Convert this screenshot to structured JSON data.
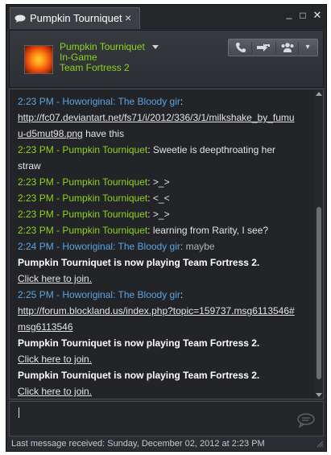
{
  "window": {
    "tab_title": "Pumpkin Tourniquet",
    "tab_close": "×",
    "controls": {
      "minimize": "_",
      "maximize": "□",
      "close": "✕"
    }
  },
  "header": {
    "name": "Pumpkin Tourniquet",
    "status": "In-Game",
    "game": "Team Fortress 2",
    "buttons": [
      "call-icon",
      "invite-icon",
      "group-icon",
      "dropdown-icon"
    ],
    "more_glyph": "▾",
    "colors": {
      "name": "#8fd21f",
      "ts_blue": "#5ba4e0"
    }
  },
  "messages": [
    {
      "time": "2:23 PM",
      "sep": " - ",
      "name": "Howoriginal: The Bloody gir",
      "colon": ":",
      "text": ""
    },
    {
      "link": "http://fc07.deviantart.net/fs71/i/2012/336/3/1/milkshake_by_fumu"
    },
    {
      "link": "u-d5mut98.png",
      "text": " have this"
    },
    {
      "time": "2:23 PM",
      "sep": " - ",
      "name": "Pumpkin Tourniquet",
      "colon": ":",
      "text": " Sweetie is deepthroating her"
    },
    {
      "text": "straw"
    },
    {
      "time": "2:23 PM",
      "sep": " - ",
      "name": "Pumpkin Tourniquet",
      "colon": ":",
      "text": " >_>"
    },
    {
      "time": "2:23 PM",
      "sep": " - ",
      "name": "Pumpkin Tourniquet",
      "colon": ":",
      "text": " <_<"
    },
    {
      "time": "2:23 PM",
      "sep": " - ",
      "name": "Pumpkin Tourniquet",
      "colon": ":",
      "text": " >_>"
    },
    {
      "time": "2:23 PM",
      "sep": " - ",
      "name": "Pumpkin Tourniquet",
      "colon": ":",
      "text": " learning from Rarity, I see?"
    },
    {
      "time": "2:24 PM",
      "sep": " - ",
      "name": "Howoriginal: The Bloody gir",
      "colon": ":",
      "text": " maybe"
    },
    {
      "bold": "Pumpkin Tourniquet is now playing Team Fortress 2."
    },
    {
      "link": "Click here to join."
    },
    {
      "time": "2:25 PM",
      "sep": " - ",
      "name": "Howoriginal: The Bloody gir",
      "colon": ":",
      "text": ""
    },
    {
      "link": "http://forum.blockland.us/index.php?topic=159737.msg6113546#"
    },
    {
      "link": "msg6113546"
    },
    {
      "bold": "Pumpkin Tourniquet is now playing Team Fortress 2."
    },
    {
      "link": "Click here to join."
    },
    {
      "bold": "Pumpkin Tourniquet is now playing Team Fortress 2."
    },
    {
      "link": "Click here to join."
    }
  ],
  "input": {
    "value": "",
    "send_icon": "chat-send-icon"
  },
  "status_bar": {
    "text": "Last message received: Sunday, December 02, 2012 at 2:23 PM"
  }
}
